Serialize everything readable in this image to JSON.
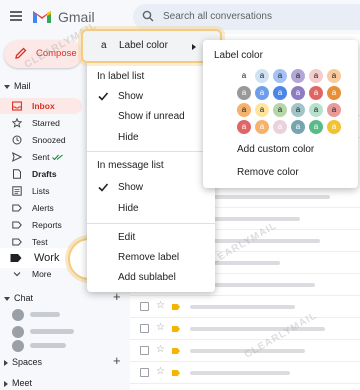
{
  "header": {
    "app_name": "Gmail",
    "search_placeholder": "Search all conversations"
  },
  "sidebar": {
    "compose": "Compose",
    "mail_header": "Mail",
    "items": [
      {
        "label": "Inbox",
        "icon": "inbox-icon"
      },
      {
        "label": "Starred",
        "icon": "star-icon"
      },
      {
        "label": "Snoozed",
        "icon": "clock-icon"
      },
      {
        "label": "Sent",
        "icon": "send-icon"
      },
      {
        "label": "Drafts",
        "icon": "draft-icon"
      },
      {
        "label": "Lists",
        "icon": "list-icon"
      },
      {
        "label": "Alerts",
        "icon": "label-icon"
      },
      {
        "label": "Reports",
        "icon": "label-icon"
      },
      {
        "label": "Test",
        "icon": "label-icon"
      },
      {
        "label": "Work",
        "icon": "label-icon"
      },
      {
        "label": "More",
        "icon": "chevron-down-icon"
      }
    ],
    "chat_header": "Chat",
    "spaces_header": "Spaces",
    "meet_header": "Meet"
  },
  "menu": {
    "label_color": "Label color",
    "label_glyph": "a",
    "in_label_list": "In label list",
    "show": "Show",
    "show_if_unread": "Show if unread",
    "hide": "Hide",
    "in_message_list": "In message list",
    "msg_show": "Show",
    "msg_hide": "Hide",
    "edit": "Edit",
    "remove_label": "Remove label",
    "add_sublabel": "Add sublabel"
  },
  "submenu": {
    "title": "Label color",
    "add_custom": "Add custom color",
    "remove": "Remove color",
    "swatch_glyph": "a",
    "swatches": [
      [
        "#ffffff",
        "#cfe2f3",
        "#a4c2f4",
        "#b4a7d6",
        "#f4cccc",
        "#f9cb9c"
      ],
      [
        "#999999",
        "#6d9eeb",
        "#4a86e8",
        "#8e7cc3",
        "#e06666",
        "#e69138"
      ],
      [
        "#f6b26b",
        "#ffe599",
        "#b6d7a8",
        "#a2c4c9",
        "#b7e1cd",
        "#ea9999"
      ],
      [
        "#e06666",
        "#f6b26b",
        "#ead1dc",
        "#76a5af",
        "#57bb8a",
        "#f1c232"
      ]
    ]
  },
  "watermark": "CLEARLYMAIL"
}
